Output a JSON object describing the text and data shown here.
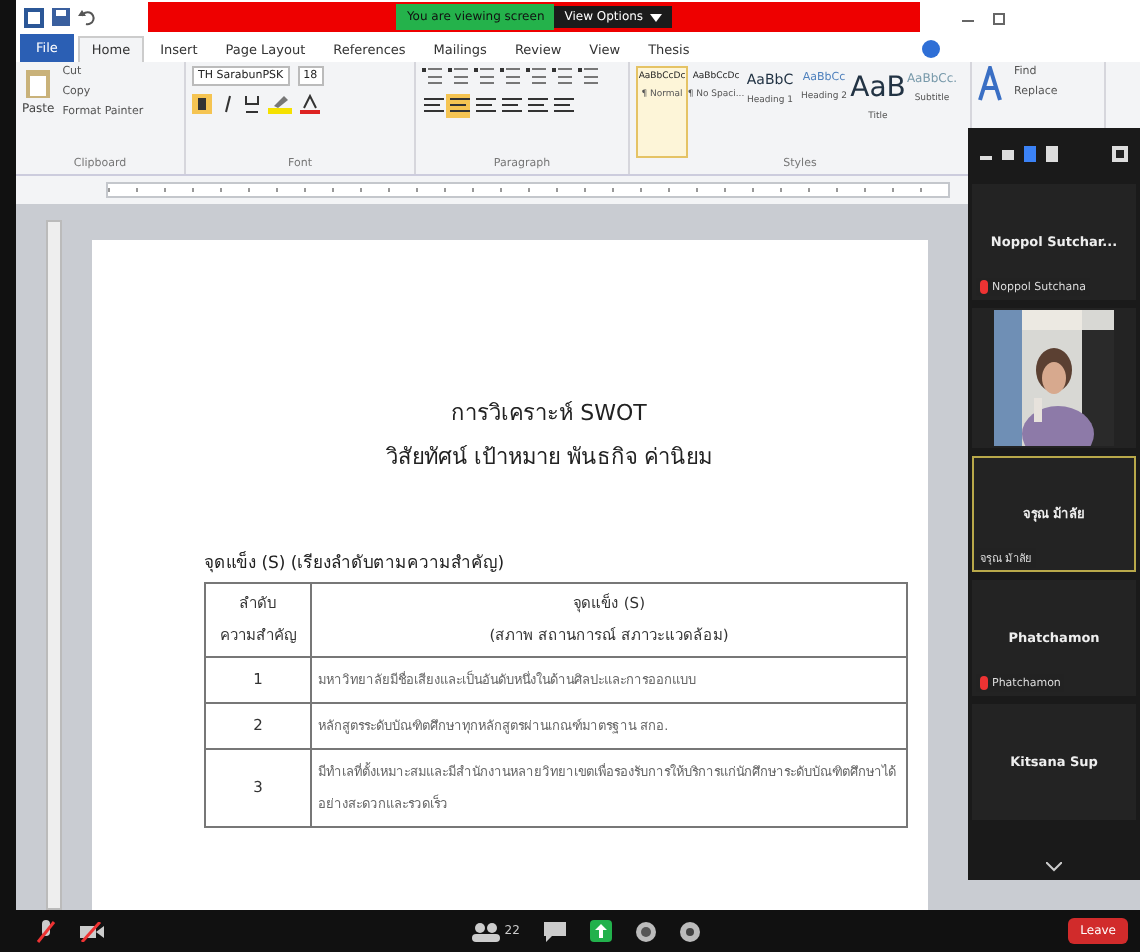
{
  "share_bar": {
    "notice": "You are viewing screen",
    "view_options": "View Options"
  },
  "ribbon_tabs": [
    {
      "label": "File",
      "kind": "file",
      "selected": false
    },
    {
      "label": "Home",
      "kind": "tab",
      "selected": true
    },
    {
      "label": "Insert",
      "kind": "tab",
      "selected": false
    },
    {
      "label": "Page Layout",
      "kind": "tab",
      "selected": false
    },
    {
      "label": "References",
      "kind": "tab",
      "selected": false
    },
    {
      "label": "Mailings",
      "kind": "tab",
      "selected": false
    },
    {
      "label": "Review",
      "kind": "tab",
      "selected": false
    },
    {
      "label": "View",
      "kind": "tab",
      "selected": false
    },
    {
      "label": "Thesis",
      "kind": "tab",
      "selected": false
    }
  ],
  "clipboard": {
    "paste": "Paste",
    "cut": "Cut",
    "copy": "Copy",
    "format_painter": "Format Painter",
    "label": "Clipboard"
  },
  "font": {
    "family": "TH SarabunPSK",
    "size": "18",
    "bold": true,
    "label": "Font"
  },
  "paragraph": {
    "label": "Paragraph"
  },
  "styles": {
    "label": "Styles",
    "items": [
      {
        "sample": "AaBbCcDc",
        "name": "¶ Normal",
        "kind": "body",
        "selected": true
      },
      {
        "sample": "AaBbCcDc",
        "name": "¶ No Spaci...",
        "kind": "body",
        "selected": false
      },
      {
        "sample": "AaBbC",
        "name": "Heading 1",
        "kind": "heading1",
        "selected": false
      },
      {
        "sample": "AaBbCc",
        "name": "Heading 2",
        "kind": "heading2",
        "selected": false
      },
      {
        "sample": "AaB",
        "name": "Title",
        "kind": "title",
        "selected": false
      },
      {
        "sample": "AaBbCc.",
        "name": "Subtitle",
        "kind": "subtitle",
        "selected": false
      }
    ]
  },
  "editing": {
    "find": "Find",
    "replace": "Replace"
  },
  "document": {
    "title": "การวิเคราะห์ SWOT",
    "subtitle": "วิสัยทัศน์ เป้าหมาย พันธกิจ ค่านิยม",
    "section": "จุดแข็ง (S)  (เรียงลำดับตามความสำคัญ)",
    "table": {
      "columns": [
        "ลำดับ\nความสำคัญ",
        "จุดแข็ง (S)\n(สภาพ สถานการณ์ สภาวะแวดล้อม)"
      ],
      "rows": [
        [
          "1",
          "มหาวิทยาลัยมีชื่อเสียงและเป็นอันดับหนึ่งในด้านศิลปะและการออกแบบ"
        ],
        [
          "2",
          "หลักสูตรระดับบัณฑิตศึกษาทุกหลักสูตรผ่านเกณฑ์มาตรฐาน สกอ."
        ],
        [
          "3",
          "มีทำเลที่ตั้งเหมาะสมและมีสำนักงานหลายวิทยาเขตเพื่อรองรับการให้บริการแก่นักศึกษาระดับบัณฑิตศึกษาได้อย่างสะดวกและรวดเร็ว"
        ]
      ]
    }
  },
  "participants": [
    {
      "kind": "name",
      "name": "Noppol Sutchar...",
      "label": "Noppol Sutchana",
      "muted": true,
      "speaking": false
    },
    {
      "kind": "video",
      "muted": false,
      "speaking": false
    },
    {
      "kind": "name",
      "name": "จรุณ ม้าลัย",
      "label": "จรุณ ม้าลัย",
      "muted": false,
      "speaking": true
    },
    {
      "kind": "name",
      "name": "Phatchamon",
      "label": "Phatchamon",
      "muted": true,
      "speaking": false
    },
    {
      "kind": "name",
      "name": "Kitsana Sup",
      "muted": false,
      "speaking": false
    }
  ],
  "toolbar": {
    "audio_muted": true,
    "video_off": true,
    "participant_count": "22",
    "leave": "Leave"
  }
}
